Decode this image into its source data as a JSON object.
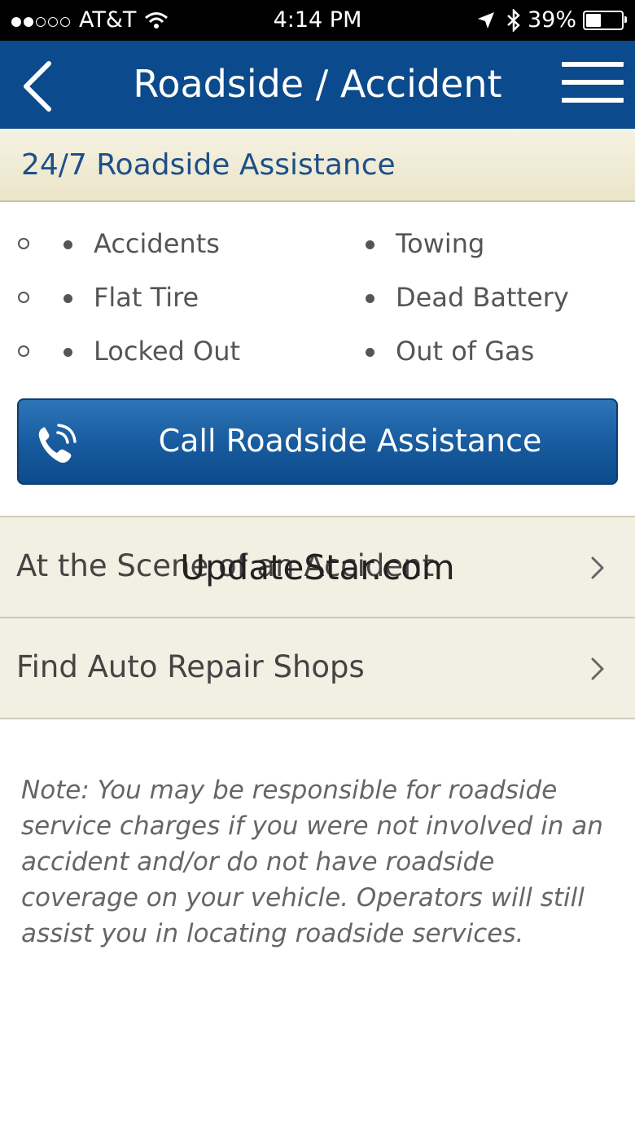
{
  "status_bar": {
    "signal_dots": [
      true,
      true,
      false,
      false,
      false
    ],
    "carrier": "AT&T",
    "time": "4:14 PM",
    "battery_percent_text": "39%",
    "battery_level": 0.39,
    "icons": [
      "signal-dots-icon",
      "wifi-icon",
      "location-arrow-icon",
      "bluetooth-icon",
      "battery-icon"
    ]
  },
  "nav": {
    "title": "Roadside / Accident",
    "back_icon": "chevron-left-icon",
    "menu_icon": "hamburger-menu-icon"
  },
  "section_header": "24/7 Roadside Assistance",
  "services": {
    "rows": [
      [
        "Accidents",
        "Towing"
      ],
      [
        "Flat Tire",
        "Dead Battery"
      ],
      [
        "Locked Out",
        "Out of Gas"
      ]
    ]
  },
  "call_button": {
    "label": "Call Roadside Assistance",
    "icon": "phone-ringing-icon"
  },
  "list_items": [
    {
      "label": "At the Scene of an Accident",
      "icon": "chevron-right-icon"
    },
    {
      "label": "Find Auto Repair Shops",
      "icon": "chevron-right-icon"
    }
  ],
  "watermark": "UpdateStar.com",
  "note": "Note: You may be responsible for roadside service charges if you were not involved in an accident and/or do not have roadside coverage on your vehicle. Operators will still assist you in locating roadside services.",
  "colors": {
    "nav_bg": "#0b4a8c",
    "header_text": "#1d4f8a",
    "button_bg": "#175a9e",
    "list_bg": "#f2efe3"
  }
}
